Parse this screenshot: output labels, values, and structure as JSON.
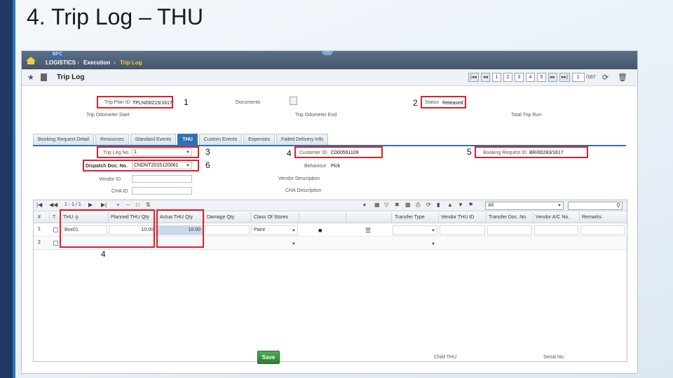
{
  "slide": {
    "title": "4. Trip Log – THU"
  },
  "topbar": {
    "badge": "BPC",
    "breadcrumb": [
      "LOGISTICS",
      "Execution",
      "Trip Log"
    ],
    "collapse_icon": "chevron-up-icon",
    "collapse_glyph": "˄"
  },
  "toolbar": {
    "title": "Trip Log",
    "pager": {
      "first": "|◂◂",
      "prev": "◂◂",
      "pages": [
        "1",
        "2",
        "3",
        "4",
        "5"
      ],
      "next": "▸▸",
      "last": "▸▸|",
      "current": "1",
      "total": "/167"
    }
  },
  "header": {
    "trip_plan_id_label": "Trip Plan ID",
    "trip_plan_id": "TPLN/00215/1617",
    "documents_label": "Documents",
    "status_label": "Status",
    "status": "Released",
    "trip_odometer_start_label": "Trip Odometer Start",
    "trip_odometer_end_label": "Trip Odometer End",
    "total_trip_run_label": "Total Trip Run"
  },
  "callouts": [
    "1",
    "2",
    "3",
    "4",
    "5",
    "6",
    "4"
  ],
  "tabs": [
    "Booking Request Detail",
    "Resources",
    "Standard Events",
    "THU",
    "Custom Events",
    "Expenses",
    "Failed Delivery Info"
  ],
  "active_tab": "THU",
  "thu_form": {
    "trip_leg_no_label": "Trip Leg No.",
    "trip_leg_no": "1",
    "dispatch_doc_label": "Dispatch Doc. No.",
    "dispatch_doc": "CNDNT2015120061",
    "vendor_id_label": "Vendor ID",
    "cha_id_label": "CHA ID",
    "customer_id_label": "Customer ID",
    "customer_id": "C000591109",
    "behaviour_label": "Behaviour",
    "behaviour": "Pick",
    "vendor_description_label": "Vendor Description",
    "cha_description_label": "CHA Description",
    "booking_request_id_label": "Booking Request ID",
    "booking_request_id": "BR/00283/1617"
  },
  "grid": {
    "pager_text": "1 - 1 / 1",
    "filter_value": "All",
    "columns": [
      "#",
      "T",
      "THU",
      "Planned THU Qty",
      "Actua THU Qty",
      "Damage Qty",
      "Class Of Stores",
      "",
      "",
      "Transfer Type",
      "Vendor THU ID",
      "Transfer Doc. No.",
      "Vendor A/C No.",
      "Remarks"
    ],
    "rows": [
      {
        "num": "1",
        "thu": "Box01",
        "planned_qty": "10.00",
        "actual_qty": "10.00",
        "damage_qty": "",
        "class_of_stores": "Paint"
      },
      {
        "num": "2",
        "thu": "",
        "planned_qty": "",
        "actual_qty": "",
        "damage_qty": "",
        "class_of_stores": ""
      }
    ]
  },
  "footer": {
    "save_label": "Save",
    "child_thu_label": "Child THU",
    "serial_no_label": "Serial No."
  },
  "colors": {
    "accent": "#2f6fb6",
    "callout_box": "#e0202a",
    "save": "#2e7d32",
    "topbar": "#45566b"
  }
}
